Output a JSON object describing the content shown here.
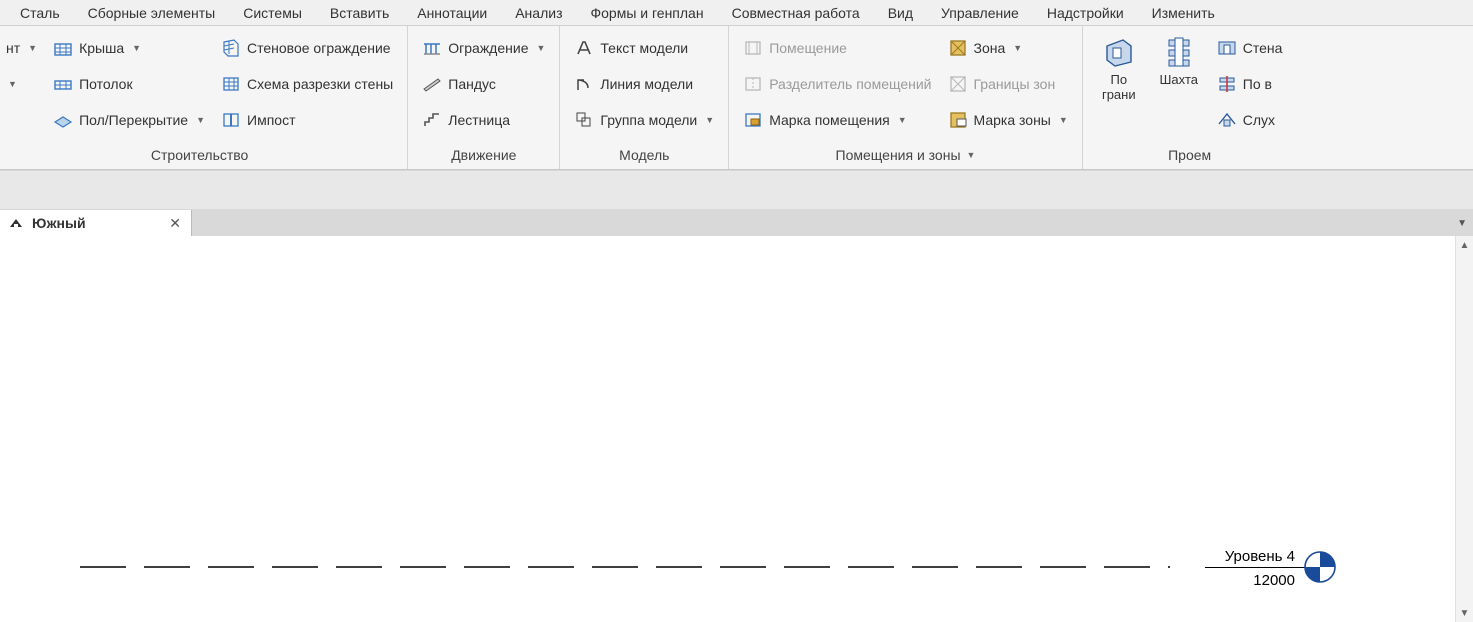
{
  "tabs": [
    "Сталь",
    "Сборные элементы",
    "Системы",
    "Вставить",
    "Аннотации",
    "Анализ",
    "Формы и генплан",
    "Совместная работа",
    "Вид",
    "Управление",
    "Надстройки",
    "Изменить"
  ],
  "panels": {
    "build": {
      "label": "Строительство",
      "c1": {
        "partial_suffix": "нт"
      },
      "c2": {
        "roof": "Крыша",
        "ceiling": "Потолок",
        "floor": "Пол/Перекрытие"
      },
      "c3": {
        "curtain_wall": "Стеновое ограждение",
        "curtain_grid": "Схема разрезки стены",
        "mullion": "Импост"
      }
    },
    "circulation": {
      "label": "Движение",
      "railing": "Ограждение",
      "ramp": "Пандус",
      "stair": "Лестница"
    },
    "model": {
      "label": "Модель",
      "model_text": "Текст модели",
      "model_line": "Линия  модели",
      "model_group": "Группа модели"
    },
    "rooms": {
      "label": "Помещения и зоны",
      "room": "Помещение",
      "room_sep": "Разделитель помещений",
      "room_tag": "Марка помещения",
      "area": "Зона",
      "area_bound": "Границы  зон",
      "area_tag": "Марка  зоны"
    },
    "opening": {
      "label": "Проем",
      "by_face": "По грани",
      "shaft": "Шахта",
      "wall": "Стена",
      "vertical": "По в",
      "dormer": "Слух"
    }
  },
  "view": {
    "tab_name": "Южный"
  },
  "canvas": {
    "level_name": "Уровень 4",
    "level_elev": "12000"
  }
}
